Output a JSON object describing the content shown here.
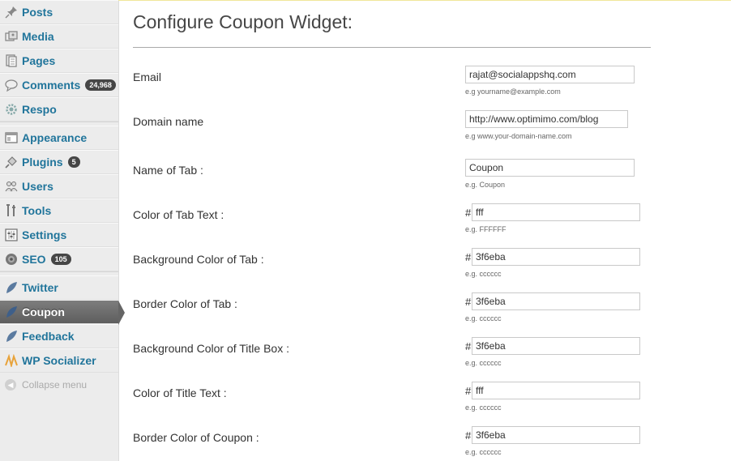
{
  "sidebar": {
    "items": [
      {
        "label": "Posts",
        "icon": "pushpin-icon"
      },
      {
        "label": "Media",
        "icon": "media-icon"
      },
      {
        "label": "Pages",
        "icon": "pages-icon"
      },
      {
        "label": "Comments",
        "icon": "comment-bubble-icon",
        "badge": "24,968"
      },
      {
        "label": "Respo",
        "icon": "gear-icon"
      },
      {
        "label": "Appearance",
        "icon": "appearance-icon"
      },
      {
        "label": "Plugins",
        "icon": "plug-icon",
        "badge": "5"
      },
      {
        "label": "Users",
        "icon": "users-icon"
      },
      {
        "label": "Tools",
        "icon": "tools-icon"
      },
      {
        "label": "Settings",
        "icon": "settings-sliders-icon"
      },
      {
        "label": "SEO",
        "icon": "seo-icon",
        "badge": "105"
      },
      {
        "label": "Twitter",
        "icon": "feather-icon"
      },
      {
        "label": "Coupon",
        "icon": "feather-icon",
        "active": true
      },
      {
        "label": "Feedback",
        "icon": "feather-icon"
      },
      {
        "label": "WP Socializer",
        "icon": "socializer-icon"
      }
    ],
    "collapse_label": "Collapse menu"
  },
  "colors": {
    "link": "#21759b",
    "active_bg": "#6d6d6d",
    "accent_line": "#f0e79a"
  },
  "main": {
    "title": "Configure Coupon Widget:",
    "fields": [
      {
        "label": "Email",
        "value": "rajat@socialappshq.com",
        "hint": "e.g yourname@example.com"
      },
      {
        "label": "Domain name",
        "value": "http://www.optimimo.com/blog",
        "hint": "e.g www.your-domain-name.com"
      },
      {
        "label": "Name of Tab :",
        "value": "Coupon",
        "hint": "e.g. Coupon"
      },
      {
        "label": "Color of Tab Text :",
        "value": "fff",
        "hint": "e.g. FFFFFF",
        "prefix": "#"
      },
      {
        "label": "Background Color of Tab :",
        "value": "3f6eba",
        "hint": "e.g. cccccc",
        "prefix": "#"
      },
      {
        "label": "Border Color of Tab :",
        "value": "3f6eba",
        "hint": "e.g. cccccc",
        "prefix": "#"
      },
      {
        "label": "Background Color of Title Box :",
        "value": "3f6eba",
        "hint": "e.g. cccccc",
        "prefix": "#"
      },
      {
        "label": "Color of Title Text :",
        "value": "fff",
        "hint": "e.g. cccccc",
        "prefix": "#"
      },
      {
        "label": "Border Color of Coupon :",
        "value": "3f6eba",
        "hint": "e.g. cccccc",
        "prefix": "#"
      }
    ]
  }
}
